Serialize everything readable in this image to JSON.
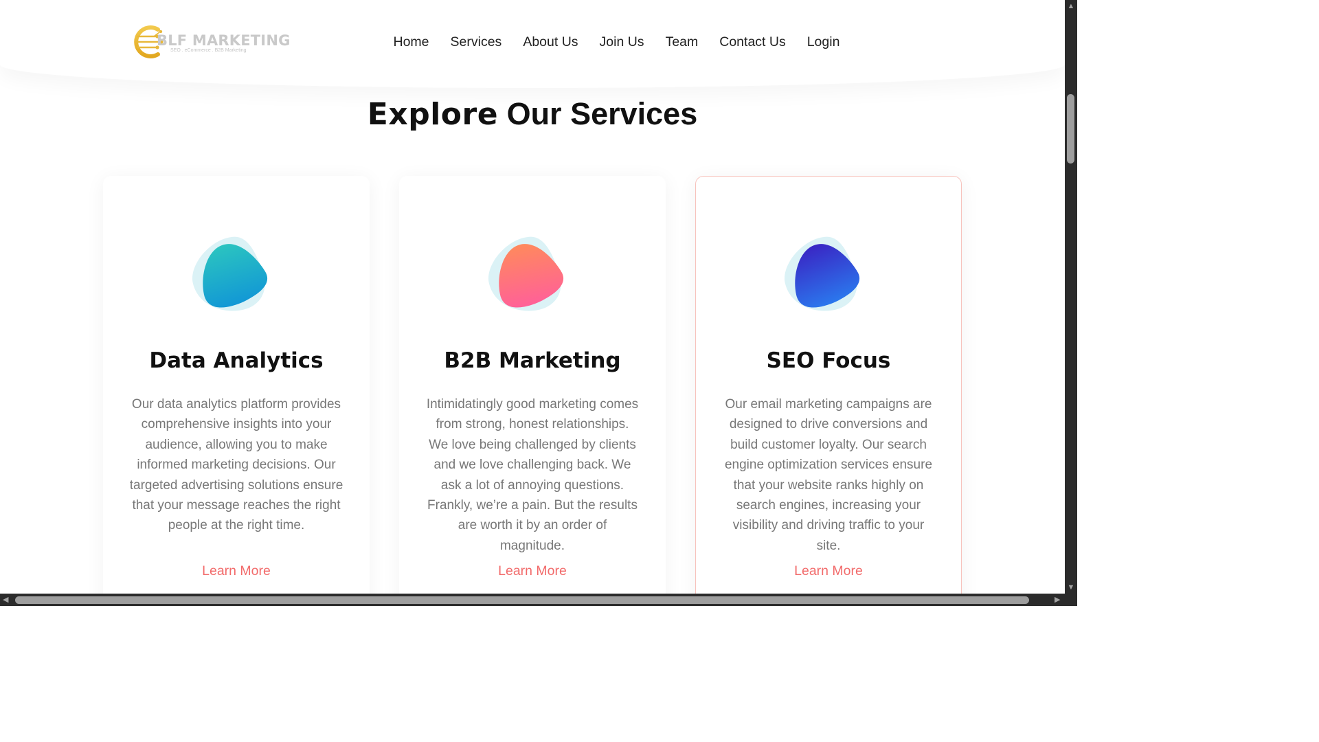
{
  "logo": {
    "text": "BLF MARKETING",
    "tagline": "SEO . eCommerce . B2B Marketing",
    "icon": "circuit-e-logo-icon",
    "color": "#e8b83a"
  },
  "nav": {
    "items": [
      "Home",
      "Services",
      "About Us",
      "Join Us",
      "Team",
      "Contact Us",
      "Login"
    ]
  },
  "section": {
    "title_bold": "Explore",
    "title_rest": " Our Services"
  },
  "cards": [
    {
      "title": "Data Analytics",
      "description": "Our data analytics platform provides comprehensive insights into your audience, allowing you to make informed marketing decisions. Our targeted advertising solutions ensure that your message reaches the right people at the right time.",
      "link": "Learn More",
      "icon": "teal-blob-icon",
      "gradient": [
        "#2cc6bf",
        "#1196d6"
      ]
    },
    {
      "title": "B2B Marketing",
      "description": "Intimidatingly good marketing comes from strong, honest relationships. We love being challenged by clients and we love challenging back. We ask a lot of annoying questions. Frankly, we’re a pain. But the results are worth it by an order of magnitude.",
      "link": "Learn More",
      "icon": "coral-blob-icon",
      "gradient": [
        "#ff8a5c",
        "#ff5f9a"
      ]
    },
    {
      "title": "SEO Focus",
      "description": "Our email marketing campaigns are designed to drive conversions and build customer loyalty. Our search engine optimization services ensure that your website ranks highly on search engines, increasing your visibility and driving traffic to your site.",
      "link": "Learn More",
      "icon": "blue-blob-icon",
      "gradient": [
        "#3a22c2",
        "#2a7df0"
      ]
    }
  ],
  "colors": {
    "accent": "#f26b6b",
    "active_card_border": "#f7c3bd",
    "blob_back": "#d7f1f5"
  }
}
